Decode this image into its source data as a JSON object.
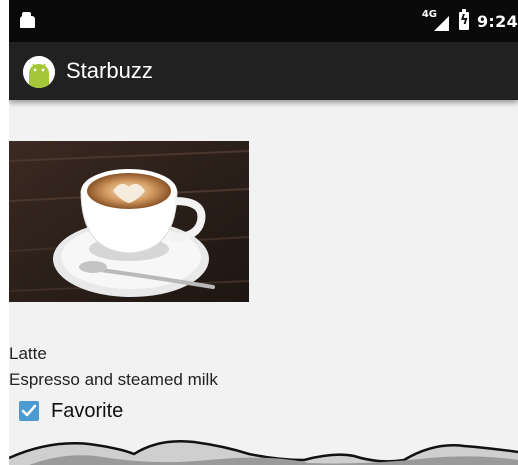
{
  "status_bar": {
    "network_type": "4G",
    "time": "9:24",
    "icons": [
      "sim-icon",
      "signal-icon",
      "battery-charging-icon"
    ]
  },
  "app_bar": {
    "icon": "android-icon",
    "title": "Starbuzz"
  },
  "drink": {
    "image": "latte-coffee-cup-image",
    "name": "Latte",
    "description": "Espresso and steamed milk"
  },
  "favorite": {
    "label": "Favorite",
    "checked": true
  },
  "colors": {
    "status_bar": "#0a0a0a",
    "app_bar": "#212121",
    "background": "#f2f2f2",
    "checkbox": "#4b9bd1",
    "android_green": "#a4c639"
  }
}
